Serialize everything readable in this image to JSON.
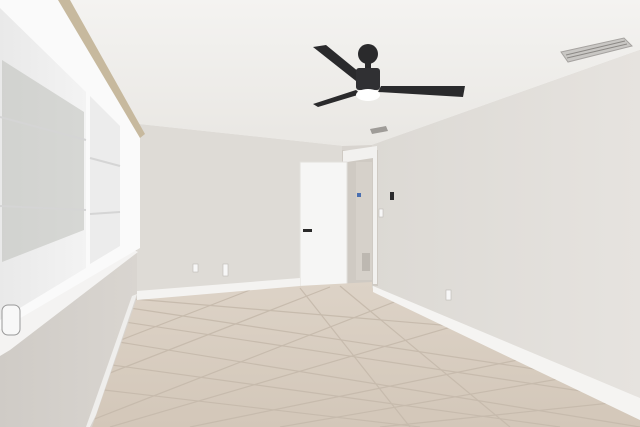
{
  "scene": {
    "description_type": "empty-room-photo",
    "elements": [
      "ceiling",
      "ceiling-fan",
      "hvac-vent",
      "window-with-shades",
      "door",
      "tile-floor",
      "baseboards",
      "outlets",
      "light-switch"
    ]
  },
  "colors": {
    "ceiling": "#f1f0ee",
    "wall_left": "#d9d6d1",
    "wall_back": "#dedbd6",
    "wall_right": "#e4e1dc",
    "floor": "#d7ccbf",
    "grout": "#c5b9ab",
    "baseboard": "#f4f3f1",
    "door": "#f6f6f5",
    "fan": "#2a2a2c",
    "shade": "#eeeeee"
  }
}
